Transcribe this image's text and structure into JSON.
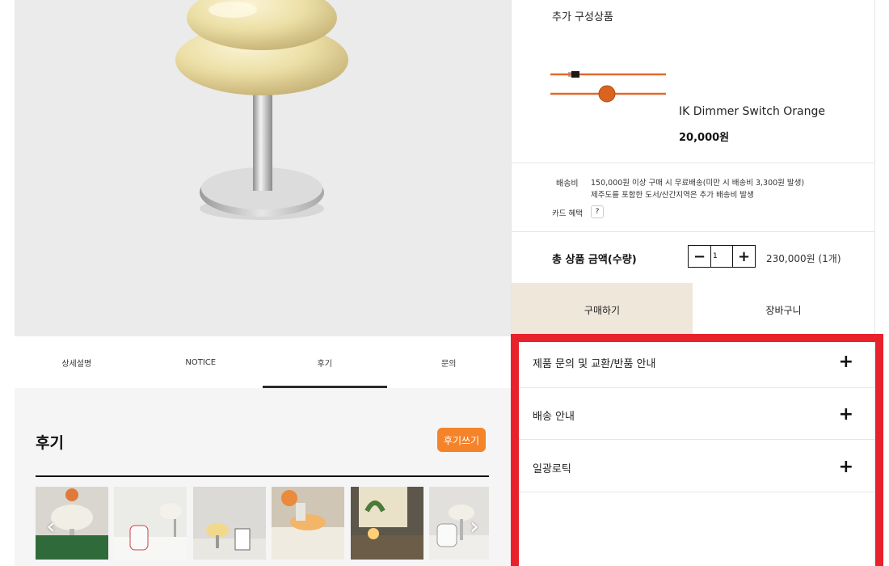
{
  "tabs": [
    {
      "label": "상세설명"
    },
    {
      "label": "NOTICE"
    },
    {
      "label": "후기"
    },
    {
      "label": "문의"
    }
  ],
  "review": {
    "title": "후기",
    "write_button": "후기쓰기"
  },
  "addon": {
    "title": "추가 구성상품",
    "product_name": "IK Dimmer Switch Orange",
    "price": "20,000원"
  },
  "shipping": {
    "label": "배송비",
    "line1": "150,000원 이상 구매 시 무료배송(미만 시 배송비 3,300원 발생)",
    "line2": "제주도를 포함한 도서/산간지역은 추가 배송비 발생",
    "card_label": "카드 혜택",
    "card_help": "?"
  },
  "total": {
    "label": "총 상품 금액(수량)",
    "quantity": "1",
    "minus": "−",
    "plus": "+",
    "price": "230,000원 (1개)"
  },
  "actions": {
    "buy": "구매하기",
    "cart": "장바구니"
  },
  "accordion": [
    {
      "label": "제품 문의 및 교환/반품 안내",
      "icon": "+"
    },
    {
      "label": "배송 안내",
      "icon": "+"
    },
    {
      "label": "일광로틱",
      "icon": "+"
    }
  ],
  "carousel": {
    "prev": "‹",
    "next": "›"
  },
  "colors": {
    "accent_orange": "#f5832a",
    "buy_bg": "#efe7da",
    "highlight_red": "#e8212b"
  }
}
